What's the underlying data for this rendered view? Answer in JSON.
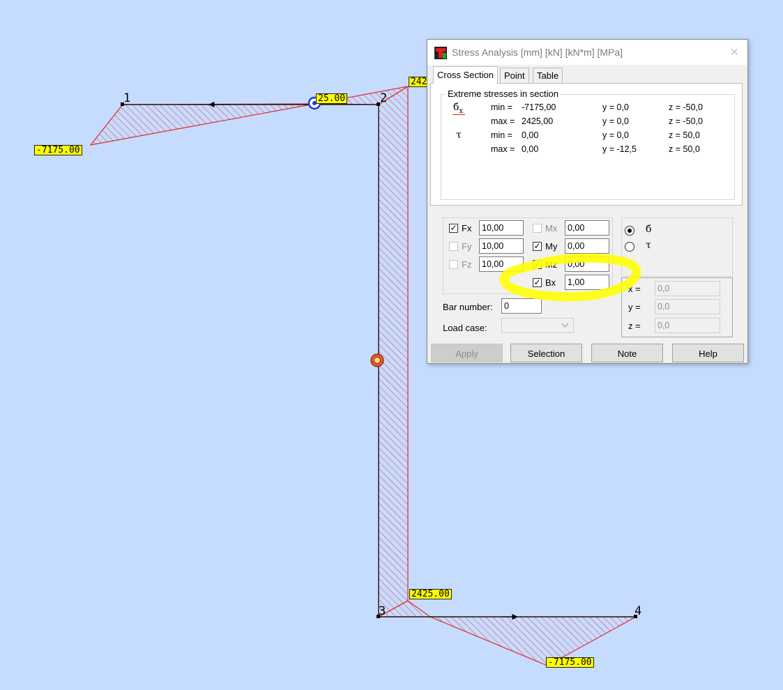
{
  "diagram": {
    "node_labels": [
      "1",
      "2",
      "3",
      "4"
    ],
    "value_tags": {
      "top_left": "-7175.00",
      "top_mid": "25.00",
      "top_right": "242",
      "bottom_mid": "2425.00",
      "bottom_right": "-7175.00"
    },
    "colors": {
      "background": "#c6dcff",
      "hatch": "#e0282d",
      "tag": "#ffff00"
    }
  },
  "window": {
    "title": "Stress Analysis   [mm] [kN] [kN*m] [MPa]",
    "close_glyph": "✕",
    "tabs": [
      {
        "label": "Cross Section",
        "active": true
      },
      {
        "label": "Point",
        "active": false
      },
      {
        "label": "Table",
        "active": false
      }
    ],
    "extreme": {
      "legend": "Extreme stresses in section",
      "sigma_symbol": "б",
      "sigma_sub": "x",
      "tau_symbol": "τ",
      "rows": [
        {
          "kind": "min =",
          "value": "-7175,00",
          "y": "y =  0,0",
          "z": "z = -50,0"
        },
        {
          "kind": "max =",
          "value": "2425,00",
          "y": "y =  0,0",
          "z": "z = -50,0"
        },
        {
          "kind": "min =",
          "value": "0,00",
          "y": "y =  0,0",
          "z": "z = 50,0"
        },
        {
          "kind": "max =",
          "value": "0,00",
          "y": "y =  -12,5",
          "z": "z = 50,0"
        }
      ]
    },
    "forces": [
      {
        "label": "Fx",
        "checked": true,
        "enabled": true,
        "value": "10,00"
      },
      {
        "label": "Fy",
        "checked": false,
        "enabled": false,
        "value": "10,00"
      },
      {
        "label": "Fz",
        "checked": false,
        "enabled": false,
        "value": "10,00"
      }
    ],
    "moments": [
      {
        "label": "Mx",
        "checked": false,
        "enabled": false,
        "value": "0,00"
      },
      {
        "label": "My",
        "checked": true,
        "enabled": true,
        "value": "0,00"
      },
      {
        "label": "Mz",
        "checked": true,
        "enabled": true,
        "value": "0,00"
      },
      {
        "label": "Bx",
        "checked": true,
        "enabled": true,
        "value": "1,00"
      }
    ],
    "stress_type": {
      "options": [
        {
          "symbol": "б",
          "selected": true
        },
        {
          "symbol": "τ",
          "selected": false
        }
      ]
    },
    "coords": [
      {
        "label": "x =",
        "value": "0,0"
      },
      {
        "label": "y =",
        "value": "0,0"
      },
      {
        "label": "z =",
        "value": "0,0"
      }
    ],
    "bar_number": {
      "label": "Bar number:",
      "value": "0"
    },
    "load_case": {
      "label": "Load case:",
      "value": ""
    },
    "buttons": {
      "apply": "Apply",
      "selection": "Selection",
      "note": "Note",
      "help": "Help"
    },
    "check_mark": "✓"
  }
}
